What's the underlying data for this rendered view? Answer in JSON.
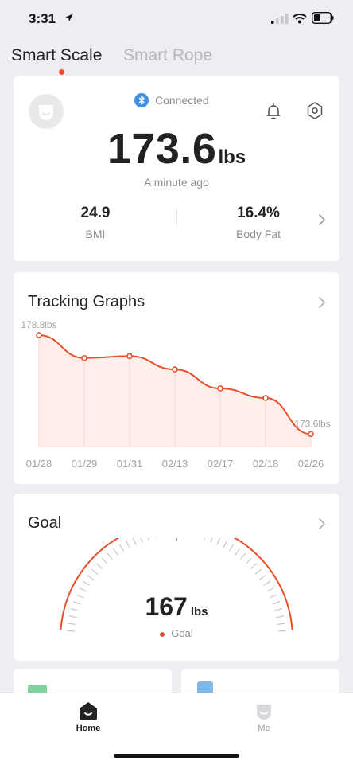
{
  "status_bar": {
    "time": "3:31"
  },
  "top_tabs": [
    {
      "label": "Smart Scale",
      "active": true
    },
    {
      "label": "Smart Rope",
      "active": false
    }
  ],
  "summary": {
    "connection_status": "Connected",
    "weight": "173.6",
    "weight_unit": "lbs",
    "updated": "A minute ago",
    "bmi_value": "24.9",
    "bmi_label": "BMI",
    "body_fat_value": "16.4%",
    "body_fat_label": "Body Fat"
  },
  "tracking": {
    "title": "Tracking Graphs"
  },
  "chart_data": {
    "type": "area",
    "categories": [
      "01/28",
      "01/29",
      "01/31",
      "02/13",
      "02/17",
      "02/18",
      "02/26"
    ],
    "values": [
      178.8,
      177.6,
      177.7,
      177.0,
      176.0,
      175.5,
      173.6
    ],
    "first_label": "178.8lbs",
    "last_label": "173.6lbs",
    "ylim": [
      172.9,
      179.6
    ],
    "line_color": "#e8502c",
    "fill_color": "#fdeee9"
  },
  "goal": {
    "title": "Goal",
    "value": "167",
    "unit": "lbs",
    "legend": "Goal"
  },
  "tabbar": {
    "home_label": "Home",
    "me_label": "Me"
  },
  "colors": {
    "accent": "#e8502c",
    "bluetooth": "#3d8fe0"
  }
}
